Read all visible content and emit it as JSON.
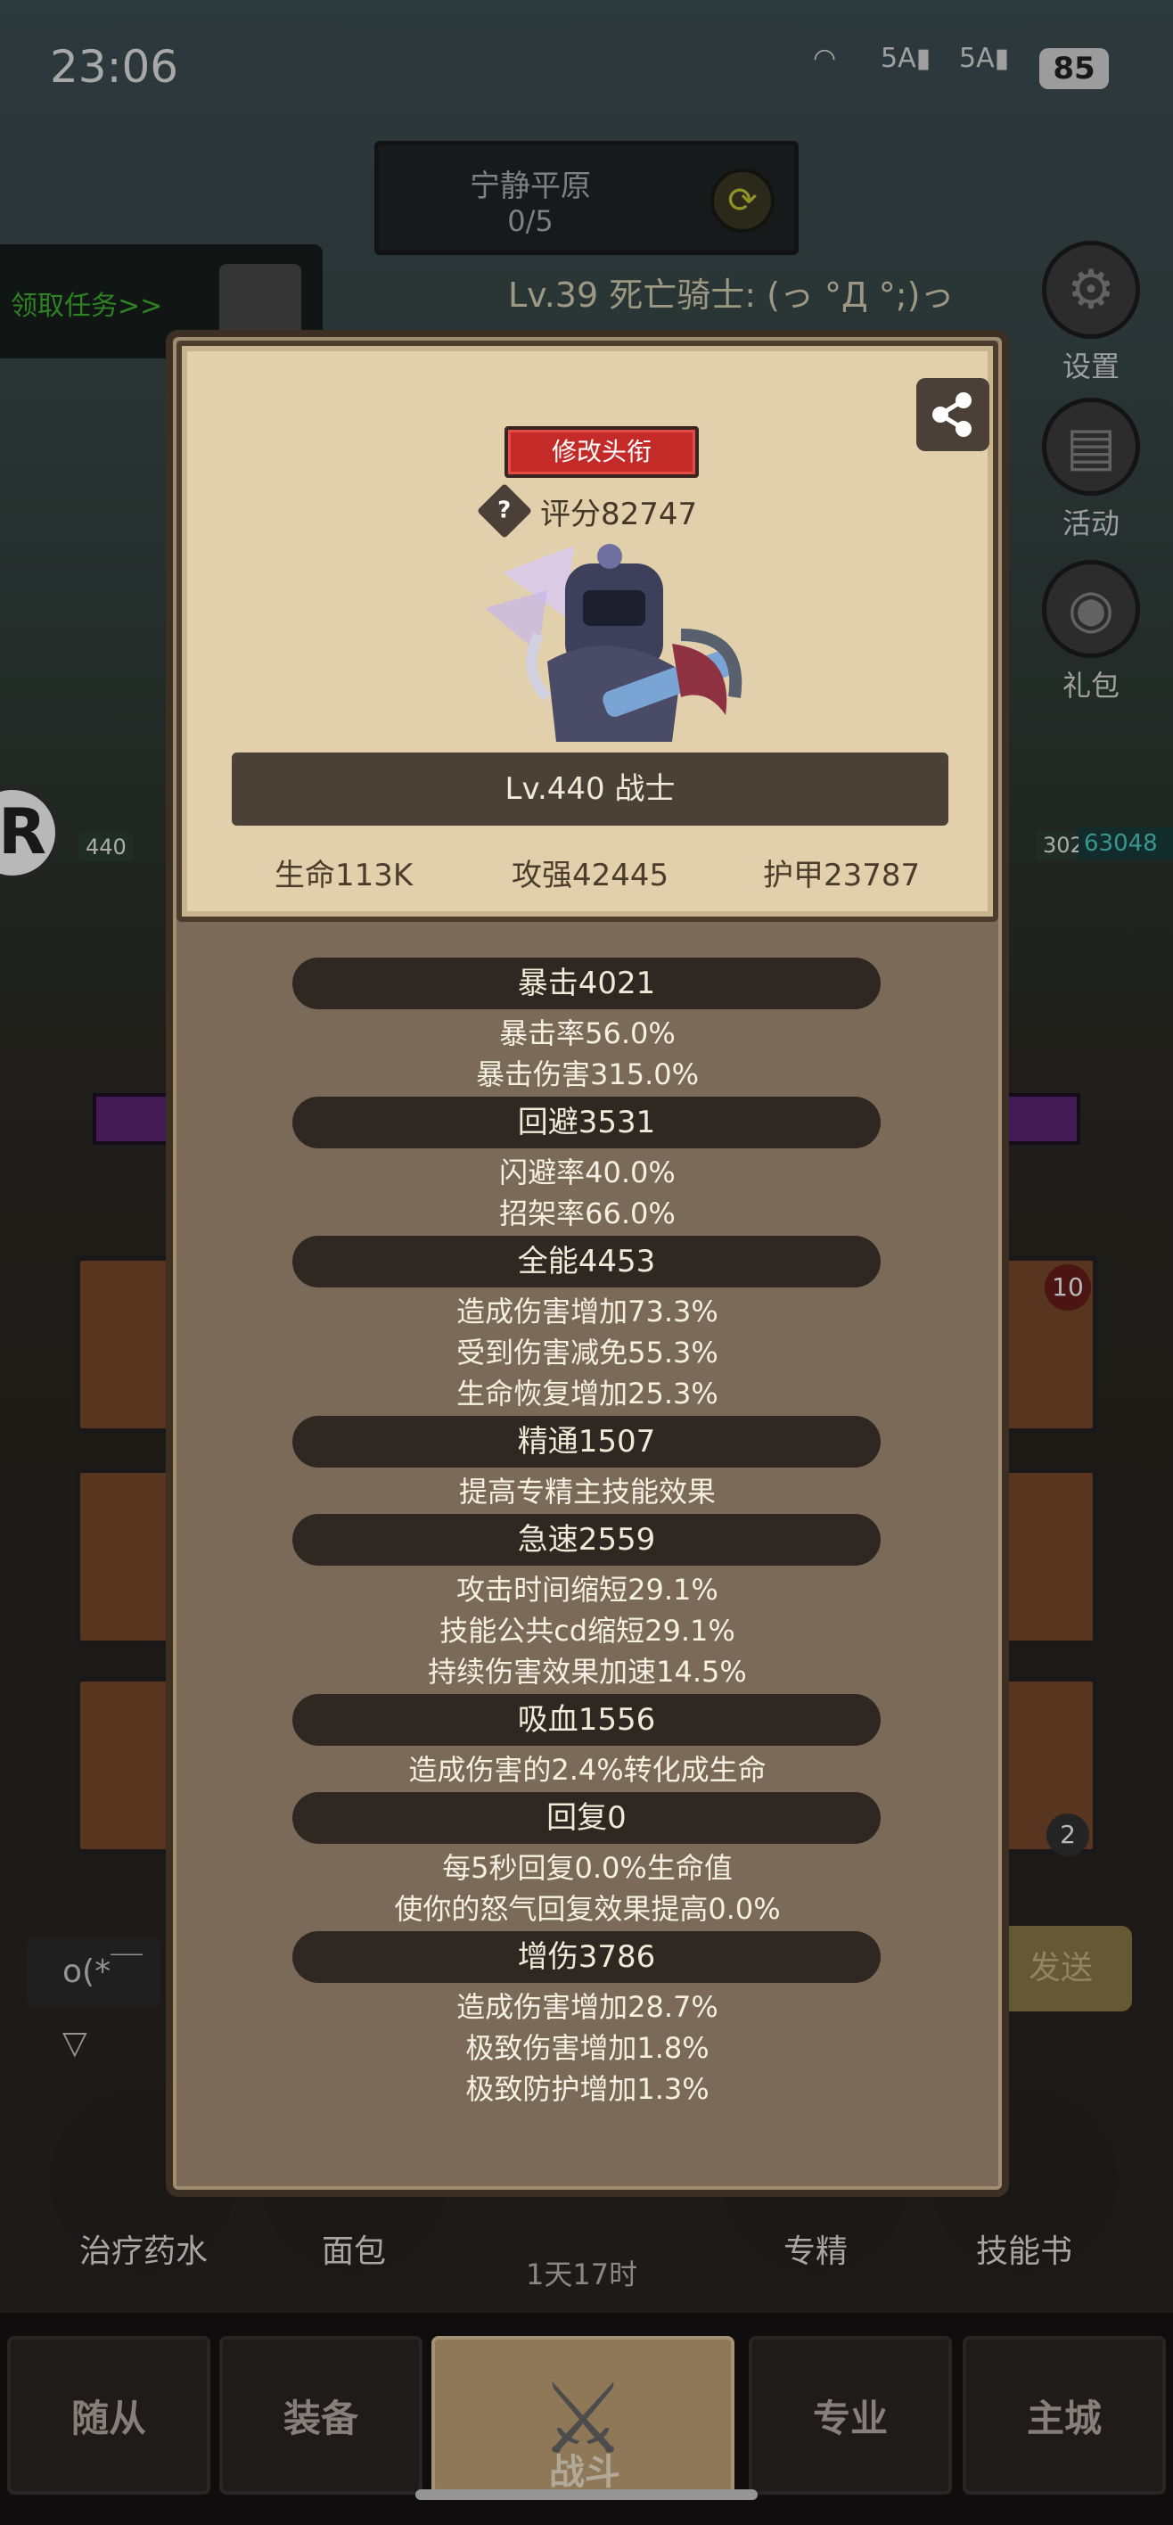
{
  "status_bar": {
    "time": "23:06",
    "net1": "5A",
    "net2": "5A",
    "battery": "85"
  },
  "zone": {
    "name": "宁静平原",
    "progress": "0/5"
  },
  "quest_tab": {
    "label": "领取任务>>"
  },
  "enemy_label": "Lv.39 死亡骑士: (っ °Д °;)っ",
  "side_menu": [
    {
      "label": "设置"
    },
    {
      "label": "活动"
    },
    {
      "label": "礼包"
    }
  ],
  "battle": {
    "left_level": "440",
    "right_level": "302",
    "right_hp": "63048"
  },
  "slot_badges": {
    "top_right": "10",
    "bottom_right": "2"
  },
  "chat": {
    "text": "o(*￣▽",
    "send": "发送"
  },
  "items": [
    {
      "label": "治疗药水"
    },
    {
      "label": "面包"
    },
    {
      "label": "专精"
    },
    {
      "label": "技能书"
    }
  ],
  "timer": "1天17时",
  "nav": [
    {
      "label": "随从"
    },
    {
      "label": "装备"
    },
    {
      "label": "战斗"
    },
    {
      "label": "专业"
    },
    {
      "label": "主城"
    }
  ],
  "modal": {
    "title_button": "修改头衔",
    "score_label": "评分82747",
    "hero_banner": "Lv.440 战士",
    "stats": {
      "hp": "生命113K",
      "attack": "攻强42445",
      "armor": "护甲23787"
    },
    "sections": [
      {
        "title": "暴击4021",
        "lines": [
          "暴击率56.0%",
          "暴击伤害315.0%"
        ]
      },
      {
        "title": "回避3531",
        "lines": [
          "闪避率40.0%",
          "招架率66.0%"
        ]
      },
      {
        "title": "全能4453",
        "lines": [
          "造成伤害增加73.3%",
          "受到伤害减免55.3%",
          "生命恢复增加25.3%"
        ]
      },
      {
        "title": "精通1507",
        "lines": [
          "提高专精主技能效果"
        ]
      },
      {
        "title": "急速2559",
        "lines": [
          "攻击时间缩短29.1%",
          "技能公共cd缩短29.1%",
          "持续伤害效果加速14.5%"
        ]
      },
      {
        "title": "吸血1556",
        "lines": [
          "造成伤害的2.4%转化成生命"
        ]
      },
      {
        "title": "回复0",
        "lines": [
          "每5秒回复0.0%生命值",
          "使你的怒气回复效果提高0.0%"
        ]
      },
      {
        "title": "增伤3786",
        "lines": [
          "造成伤害增加28.7%",
          "极致伤害增加1.8%",
          "极致防护增加1.3%"
        ]
      }
    ]
  }
}
